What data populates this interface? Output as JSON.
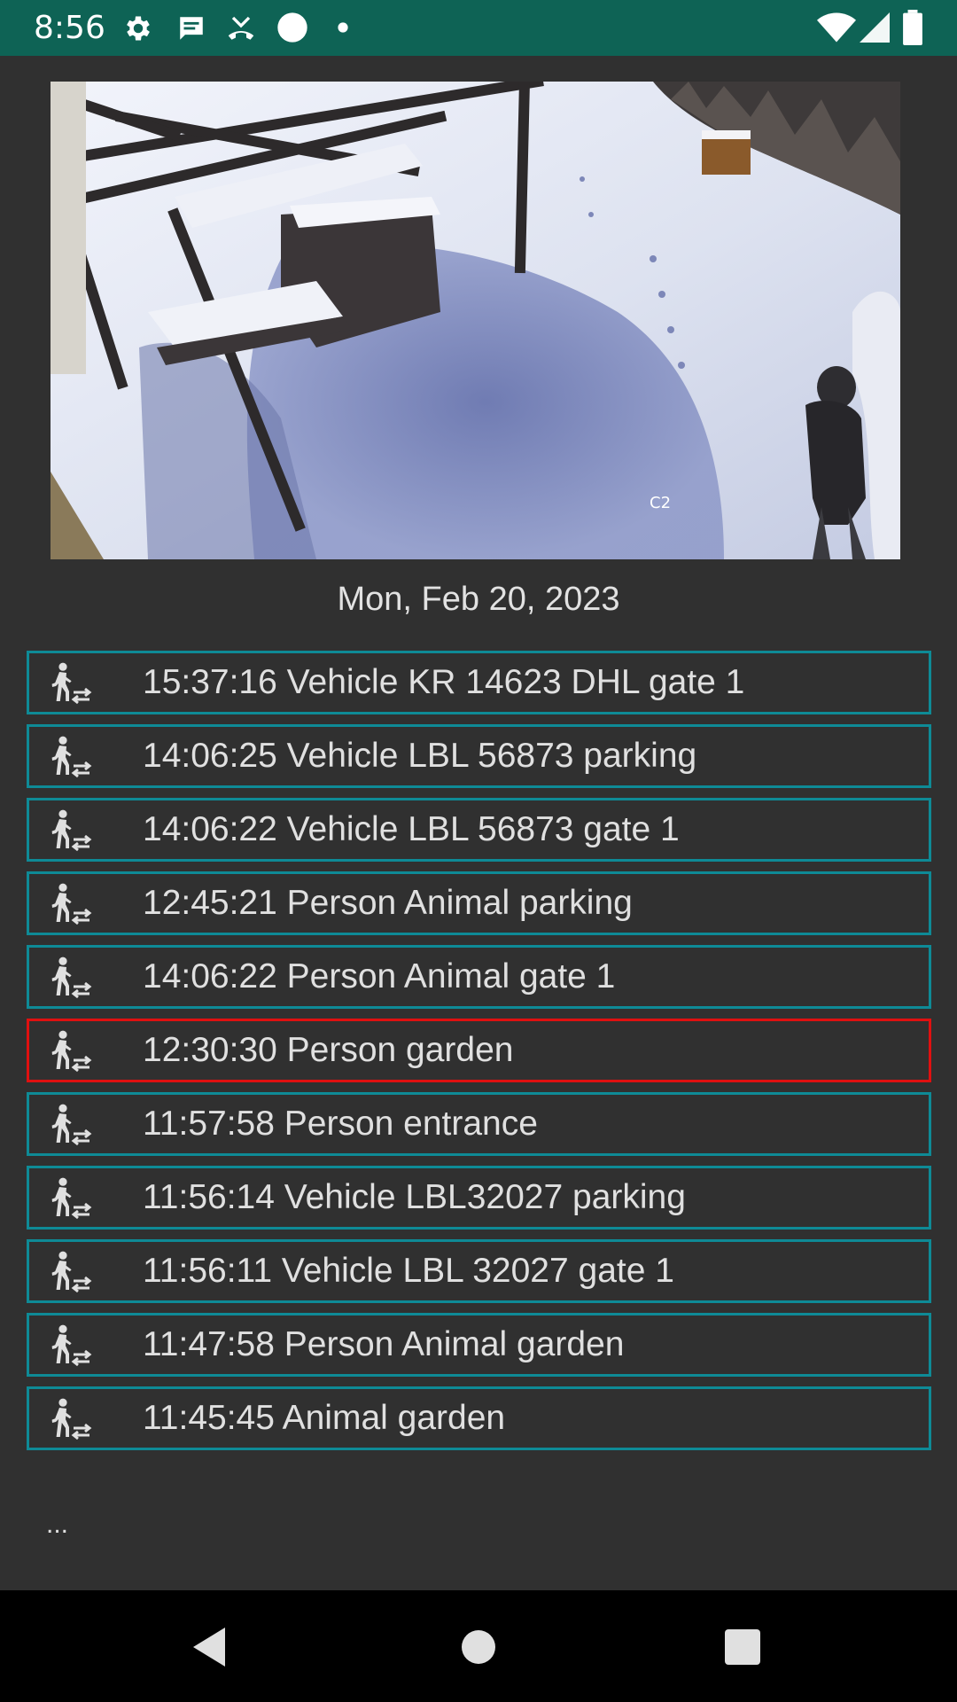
{
  "status_bar": {
    "time": "8:56",
    "left_icons": [
      "gear-icon",
      "message-icon",
      "call-icon",
      "circle-icon",
      "dot-icon"
    ],
    "right_icons": [
      "wifi-icon",
      "signal-icon",
      "battery-icon"
    ],
    "bg_color": "#0e6355"
  },
  "camera": {
    "overlay_label": "C2"
  },
  "date": "Mon, Feb 20, 2023",
  "events": [
    {
      "text": "15:37:16 Vehicle KR 14623 DHL gate 1",
      "alert": false
    },
    {
      "text": "14:06:25 Vehicle LBL 56873 parking",
      "alert": false
    },
    {
      "text": "14:06:22 Vehicle LBL 56873 gate 1",
      "alert": false
    },
    {
      "text": "12:45:21 Person Animal parking",
      "alert": false
    },
    {
      "text": "14:06:22 Person Animal gate 1",
      "alert": false
    },
    {
      "text": "12:30:30 Person garden",
      "alert": true
    },
    {
      "text": "11:57:58 Person entrance",
      "alert": false
    },
    {
      "text": "11:56:14 Vehicle LBL32027 parking",
      "alert": false
    },
    {
      "text": "11:56:11 Vehicle LBL 32027 gate 1",
      "alert": false
    },
    {
      "text": "11:47:58 Person Animal garden",
      "alert": false
    },
    {
      "text": "11:45:45 Animal garden",
      "alert": false
    }
  ],
  "event_icon": "person-motion-icon",
  "more_label": "...",
  "colors": {
    "event_border": "#0e8a96",
    "alert_border": "#e01010",
    "background": "#303030"
  },
  "nav_bar": {
    "buttons": [
      "back-icon",
      "home-icon",
      "recents-icon"
    ]
  }
}
